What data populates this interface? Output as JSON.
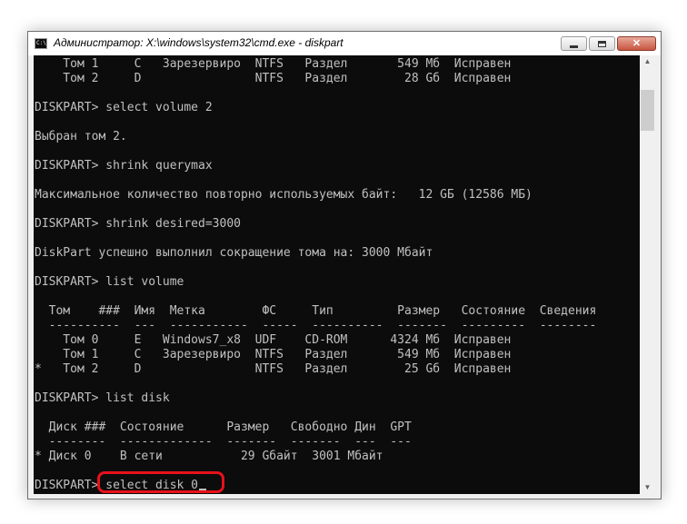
{
  "window": {
    "title": "Администратор: X:\\windows\\system32\\cmd.exe - diskpart",
    "icon_label": "C:\\"
  },
  "controls": {
    "minimize_icon": "minimize-icon",
    "maximize_icon": "maximize-icon",
    "close_icon": "close-icon",
    "close_glyph": "✕"
  },
  "console": {
    "lines": [
      "    Том 1     C   Зарезервиро  NTFS   Раздел       549 Мб  Исправен",
      "    Том 2     D                NTFS   Раздел        28 Gб  Исправен",
      "",
      "DISKPART> select volume 2",
      "",
      "Выбран том 2.",
      "",
      "DISKPART> shrink querymax",
      "",
      "Максимальное количество повторно используемых байт:   12 GБ (12586 МБ)",
      "",
      "DISKPART> shrink desired=3000",
      "",
      "DiskPart успешно выполнил сокращение тома на: 3000 Мбайт",
      "",
      "DISKPART> list volume",
      "",
      "  Том    ###  Имя  Метка        ФС     Тип         Размер   Состояние  Сведения",
      "  ----------  ---  -----------  -----  ----------  -------  ---------  --------",
      "    Том 0     E   Windows7_x8  UDF    CD-ROM      4324 Мб  Исправен",
      "    Том 1     C   Зарезервиро  NTFS   Раздел       549 Мб  Исправен",
      "*   Том 2     D                NTFS   Раздел        25 Gб  Исправен",
      "",
      "DISKPART> list disk",
      "",
      "  Диск ###  Состояние      Размер   Свободно Дин  GPT",
      "  --------  -------------  -------  -------  ---  ---",
      "* Диск 0    В сети           29 Gбайт  3001 Мбайт",
      "",
      "DISKPART> select disk 0"
    ]
  },
  "scrollbar": {
    "up_glyph": "▲",
    "down_glyph": "▼"
  }
}
